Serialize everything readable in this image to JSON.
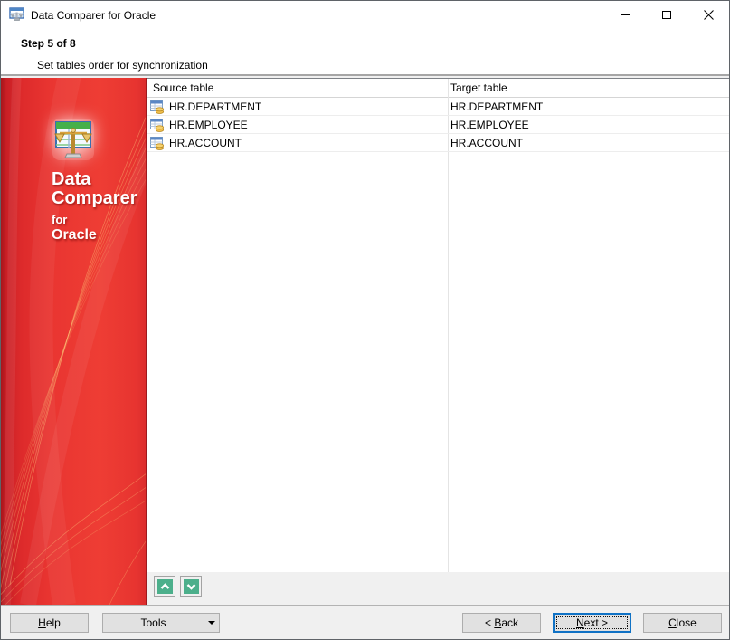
{
  "window": {
    "title": "Data Comparer for Oracle",
    "controls": {
      "minimize": "minimize",
      "maximize": "maximize",
      "close": "close"
    }
  },
  "header": {
    "step": "Step 5 of 8",
    "subtitle": "Set tables order for synchronization"
  },
  "sidebar": {
    "brand": {
      "line1": "Data",
      "line2": "Comparer",
      "line3": "for",
      "line4": "Oracle"
    },
    "logo_icon": "table-with-scales-logo"
  },
  "table": {
    "columns": [
      "Source table",
      "Target table"
    ],
    "rows": [
      {
        "icon": "table-icon",
        "source": "HR.DEPARTMENT",
        "target": "HR.DEPARTMENT"
      },
      {
        "icon": "table-icon",
        "source": "HR.EMPLOYEE",
        "target": "HR.EMPLOYEE"
      },
      {
        "icon": "table-icon",
        "source": "HR.ACCOUNT",
        "target": "HR.ACCOUNT"
      }
    ]
  },
  "order_controls": {
    "move_up": "move-up-button",
    "move_down": "move-down-button"
  },
  "footer": {
    "help": {
      "u": "H",
      "post": "elp"
    },
    "tools": {
      "label": "Tools"
    },
    "back": {
      "pre": "< ",
      "u": "B",
      "post": "ack"
    },
    "next": {
      "u": "N",
      "post": "ext >"
    },
    "close": {
      "u": "C",
      "post": "lose"
    }
  },
  "colors": {
    "sidebar_red": "#e93531",
    "sidebar_dark_red": "#9e191d",
    "gold_thread": "#ffd27e",
    "accent_focus_blue": "#1072c5",
    "move_button_green": "#4caf8b",
    "titlebar_bg": "#ffffff",
    "dialog_bg": "#f0f0f0"
  }
}
